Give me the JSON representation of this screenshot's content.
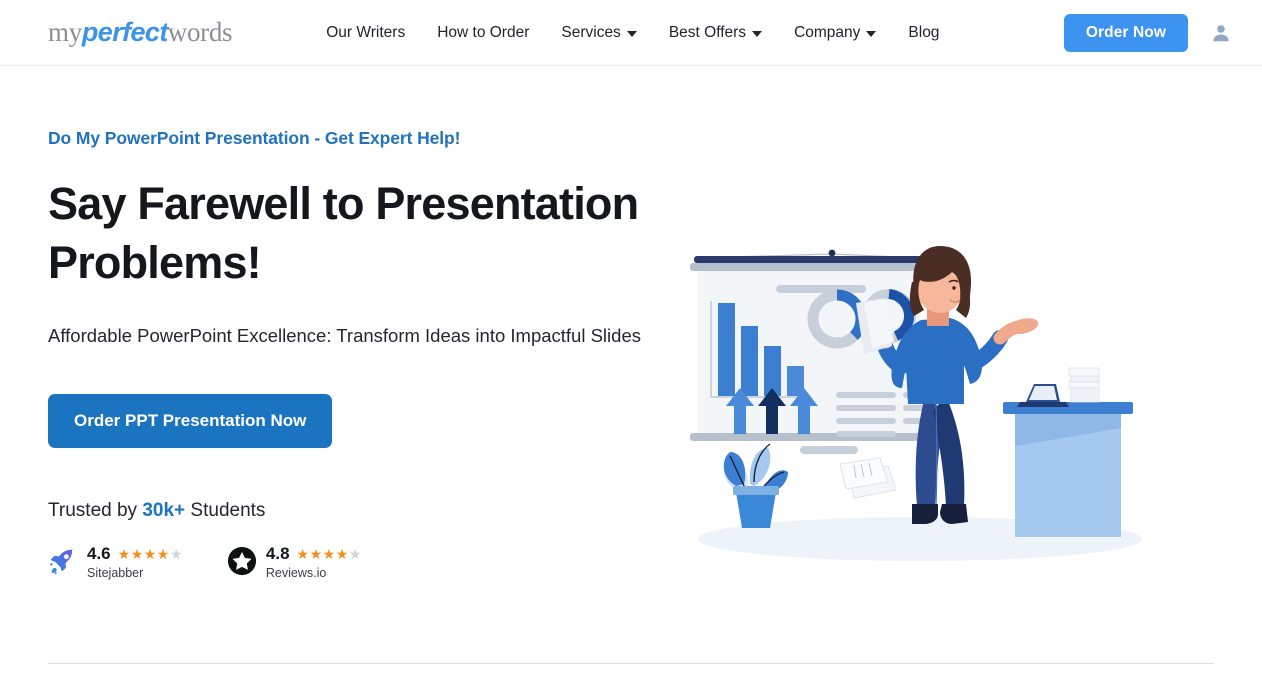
{
  "header": {
    "logo": {
      "part1": "my",
      "part2": "perfect",
      "part3": "words"
    },
    "nav": [
      {
        "label": "Our Writers",
        "has_caret": false
      },
      {
        "label": "How to Order",
        "has_caret": false
      },
      {
        "label": "Services",
        "has_caret": true
      },
      {
        "label": "Best Offers",
        "has_caret": true
      },
      {
        "label": "Company",
        "has_caret": true
      },
      {
        "label": "Blog",
        "has_caret": false
      }
    ],
    "order_now_label": "Order Now",
    "account_icon": "user-icon"
  },
  "hero": {
    "eyebrow": "Do My PowerPoint Presentation - Get Expert Help!",
    "title": "Say Farewell to Presentation Problems!",
    "subtitle": "Affordable PowerPoint Excellence: Transform Ideas into Impactful Slides",
    "cta_label": "Order PPT Presentation Now",
    "trusted_prefix": "Trusted by ",
    "trusted_count": "30k+",
    "trusted_suffix": " Students",
    "ratings": [
      {
        "icon": "rocket-icon",
        "score": "4.6",
        "stars_filled": 4,
        "stars_total": 5,
        "source": "Sitejabber"
      },
      {
        "icon": "star-badge-icon",
        "score": "4.8",
        "stars_filled": 4,
        "stars_total": 5,
        "source": "Reviews.io"
      }
    ],
    "illustration": "presenter-with-whiteboard-illustration"
  },
  "colors": {
    "brand_blue": "#3c93f0",
    "cta_blue": "#1a74c0",
    "eyebrow_blue": "#2272bd",
    "star_orange": "#f5901e",
    "star_gray": "#cfd2d8",
    "text_dark": "#15171c"
  }
}
